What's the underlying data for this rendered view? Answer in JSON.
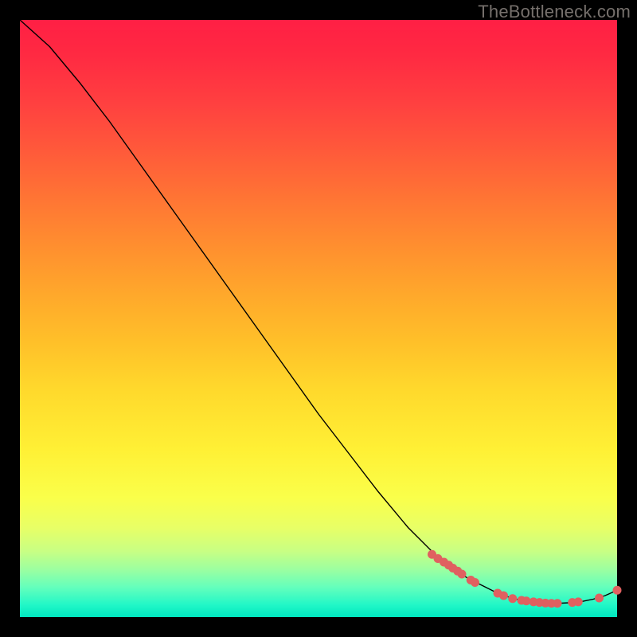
{
  "watermark": "TheBottleneck.com",
  "chart_data": {
    "type": "line",
    "title": "",
    "xlabel": "",
    "ylabel": "",
    "xlim": [
      0,
      100
    ],
    "ylim": [
      0,
      100
    ],
    "series": [
      {
        "name": "curve",
        "x": [
          0,
          5,
          10,
          15,
          20,
          25,
          30,
          35,
          40,
          45,
          50,
          55,
          60,
          65,
          70,
          72,
          75,
          78,
          80,
          82,
          84,
          86,
          88,
          90,
          92,
          94,
          96,
          98,
          100
        ],
        "y": [
          100,
          95.5,
          89.5,
          83,
          76,
          69,
          62,
          55,
          48,
          41,
          34,
          27.5,
          21,
          15,
          10,
          8.5,
          6.5,
          5,
          4,
          3.3,
          2.8,
          2.5,
          2.3,
          2.3,
          2.4,
          2.6,
          3.0,
          3.6,
          4.5
        ]
      }
    ],
    "markers": {
      "name": "highlighted-points",
      "points": [
        {
          "x": 69,
          "y": 10.5
        },
        {
          "x": 70,
          "y": 9.8
        },
        {
          "x": 71,
          "y": 9.2
        },
        {
          "x": 71.8,
          "y": 8.7
        },
        {
          "x": 72.5,
          "y": 8.2
        },
        {
          "x": 73.3,
          "y": 7.7
        },
        {
          "x": 74,
          "y": 7.2
        },
        {
          "x": 75.5,
          "y": 6.2
        },
        {
          "x": 76.2,
          "y": 5.8
        },
        {
          "x": 80,
          "y": 4.0
        },
        {
          "x": 81,
          "y": 3.6
        },
        {
          "x": 82.5,
          "y": 3.1
        },
        {
          "x": 84,
          "y": 2.8
        },
        {
          "x": 84.8,
          "y": 2.7
        },
        {
          "x": 86,
          "y": 2.55
        },
        {
          "x": 87,
          "y": 2.45
        },
        {
          "x": 88,
          "y": 2.35
        },
        {
          "x": 89,
          "y": 2.3
        },
        {
          "x": 90,
          "y": 2.3
        },
        {
          "x": 92.5,
          "y": 2.45
        },
        {
          "x": 93.5,
          "y": 2.55
        },
        {
          "x": 97,
          "y": 3.2
        },
        {
          "x": 100,
          "y": 4.5
        }
      ]
    },
    "marker_color": "#e06060",
    "line_color": "#000000",
    "gradient_stops": [
      {
        "pos": 0,
        "color": "#ff1f44"
      },
      {
        "pos": 100,
        "color": "#00e6bf"
      }
    ]
  }
}
